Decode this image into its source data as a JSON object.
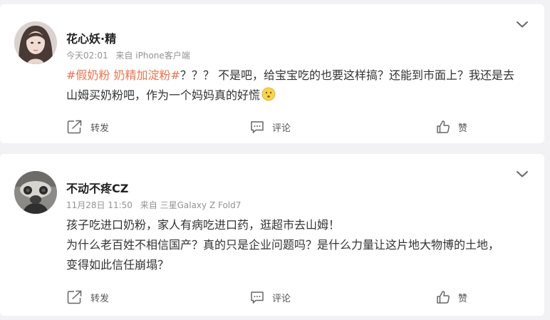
{
  "posts": [
    {
      "username": "花心妖·精",
      "time": "今天02:01",
      "source": "来自 iPhone客户端",
      "hashtags": "#假奶粉 奶精加淀粉#",
      "lines": [
        "？？？ 不是吧，给宝宝吃的也要这样搞？还能到市面上？我还是去",
        "山姆买奶粉吧，作为一个妈妈真的好慌"
      ],
      "emoji": "hushed-face-emoji",
      "actions": {
        "repost": "转发",
        "comment": "评论",
        "like": "赞"
      }
    },
    {
      "username": "不动不疼CZ",
      "time": "11月28日 11:50",
      "source": "来自 三星Galaxy Z Fold7",
      "lines": [
        "孩子吃进口奶粉，家人有病吃进口药，逛超市去山姆！",
        "为什么老百姓不相信国产？真的只是企业问题吗？是什么力量让这片地大物博的土地，",
        "变得如此信任崩塌？"
      ],
      "actions": {
        "repost": "转发",
        "comment": "评论",
        "like": "赞"
      }
    }
  ],
  "colors": {
    "page_bg": "#f2f2f5",
    "card_bg": "#ffffff",
    "hashtag": "#eb7350",
    "meta": "#939393",
    "text": "#333333"
  },
  "icons": [
    "chevron-down-icon",
    "repost-icon",
    "comment-icon",
    "like-icon"
  ]
}
